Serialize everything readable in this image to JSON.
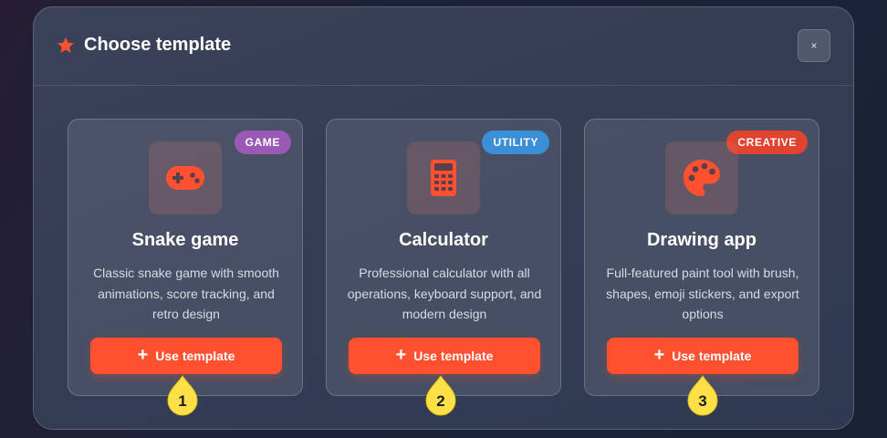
{
  "dialog": {
    "title": "Choose template",
    "close_label": "×",
    "icons": {
      "title": "star-icon",
      "close": "close-icon"
    },
    "colors": {
      "accent": "#ff512f",
      "marker": "#fde047"
    }
  },
  "cards": [
    {
      "badge": "GAME",
      "badge_color": "#9b59b6",
      "icon": "gamepad-icon",
      "title": "Snake game",
      "description": "Classic snake game with smooth animations, score tracking, and retro design",
      "button_label": "Use template",
      "marker": "1"
    },
    {
      "badge": "UTILITY",
      "badge_color": "#3b8fd6",
      "icon": "calculator-icon",
      "title": "Calculator",
      "description": "Professional calculator with all operations, keyboard support, and modern design",
      "button_label": "Use template",
      "marker": "2"
    },
    {
      "badge": "CREATIVE",
      "badge_color": "#e0432f",
      "icon": "palette-icon",
      "title": "Drawing app",
      "description": "Full-featured paint tool with brush, shapes, emoji stickers, and export options",
      "button_label": "Use template",
      "marker": "3"
    }
  ]
}
